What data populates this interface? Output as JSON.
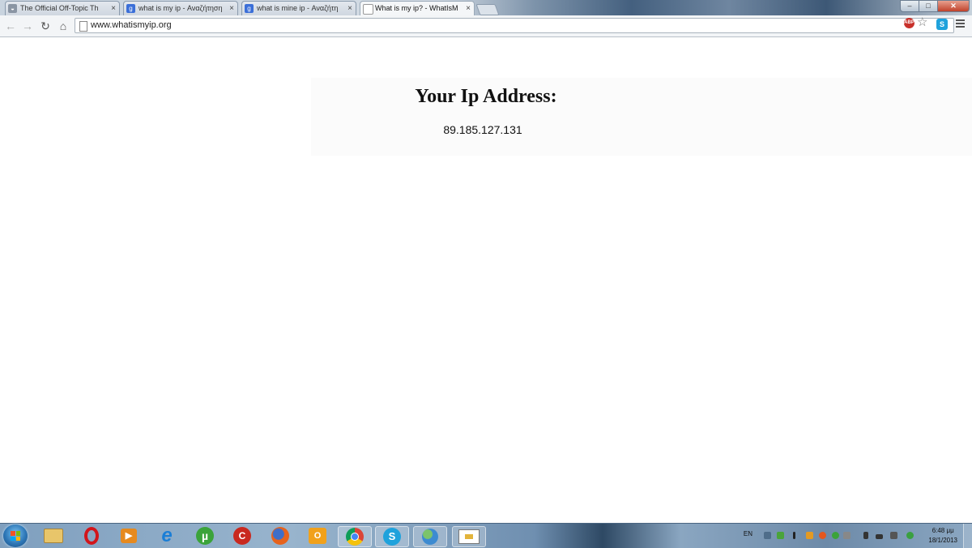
{
  "browser": {
    "tabs": [
      {
        "title": "The Official Off-Topic Th",
        "favicon": "forum-icon",
        "active": false
      },
      {
        "title": "what is my ip - Αναζήτηση",
        "favicon": "google-icon",
        "active": false
      },
      {
        "title": "what is mine ip - Αναζήτη",
        "favicon": "google-icon",
        "active": false
      },
      {
        "title": "What is my ip? - WhatIsM",
        "favicon": "page-icon",
        "active": true
      }
    ],
    "tab_close_glyph": "×",
    "address_bar": {
      "url": "www.whatismyip.org"
    },
    "window_controls": {
      "minimize": "‒",
      "maximize": "□",
      "close": "✕"
    }
  },
  "page": {
    "heading": "Your Ip Address:",
    "ip_address": "89.185.127.131"
  },
  "taskbar": {
    "pinned_apps": [
      "windows-explorer-icon",
      "opera-icon",
      "media-player-icon",
      "internet-explorer-icon",
      "utorrent-icon",
      "ccleaner-icon",
      "firefox-icon",
      "outlook-icon",
      "chrome-icon",
      "skype-icon",
      "messenger-icon",
      "paint-icon"
    ],
    "tray": {
      "language": "EN",
      "time": "6:48 μμ",
      "date": "18/1/2013"
    }
  }
}
